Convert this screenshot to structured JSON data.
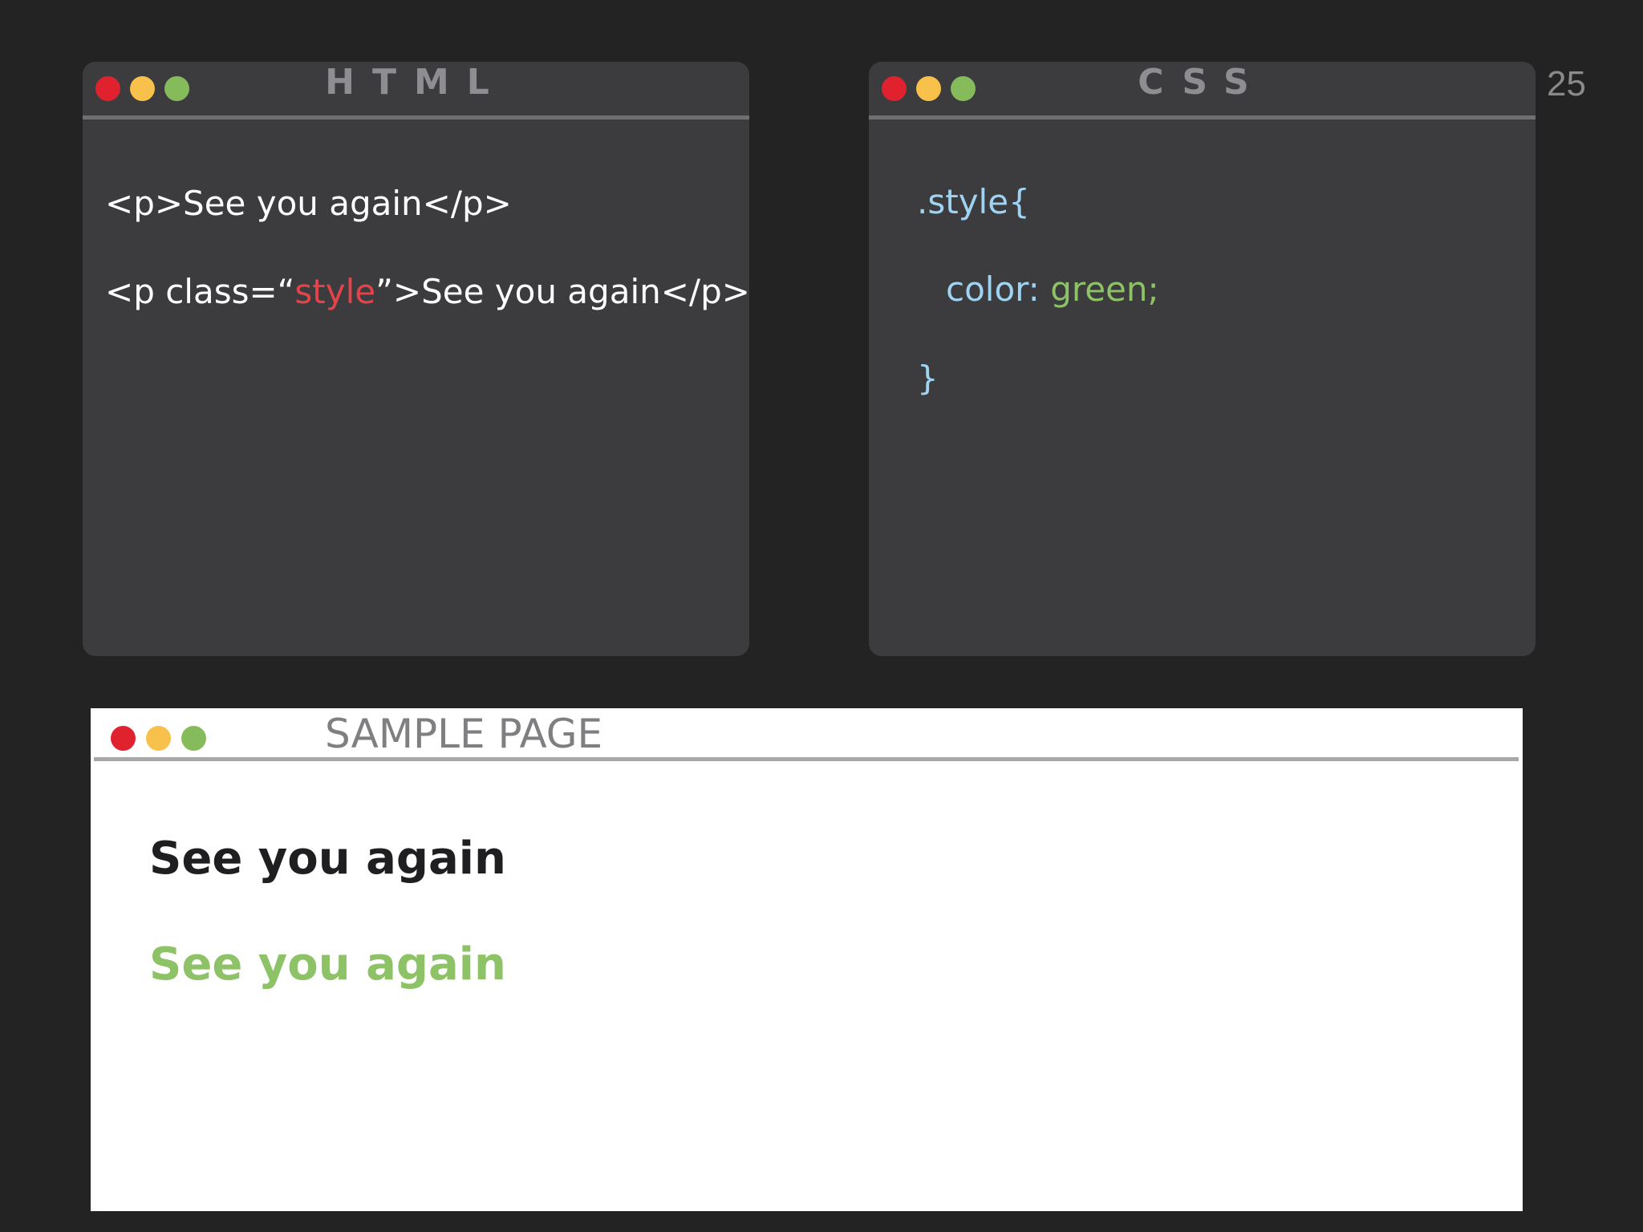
{
  "slide_number": "25",
  "html_editor": {
    "title": "HTML",
    "line1": "<p>See you again</p>",
    "line2": {
      "before": "<p class=“",
      "class_value": "style",
      "after": "”>See you again</p>"
    }
  },
  "css_editor": {
    "title": "CSS",
    "selector": ".style{",
    "property": "color: ",
    "value": "green;",
    "close": "}"
  },
  "sample_page": {
    "title": "SAMPLE PAGE",
    "paragraph1": "See you again",
    "paragraph2": "See you again"
  },
  "colors": {
    "background": "#232324",
    "editor_bg": "#3c3c3f",
    "close_dot": "#e0212e",
    "minimize_dot": "#f8c14b",
    "maximize_dot": "#86bb5b",
    "string": "#e5434a",
    "selector": "#9fd3f2",
    "green_text": "#8dc267"
  }
}
